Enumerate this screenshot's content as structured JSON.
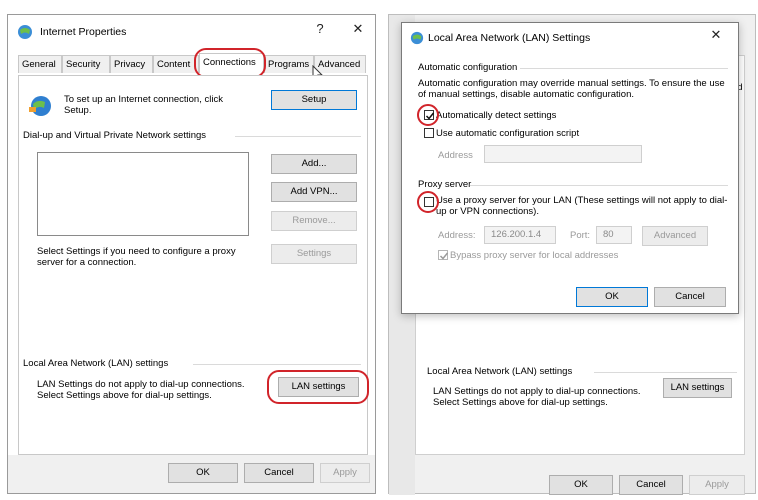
{
  "left_window": {
    "title": "Internet Properties",
    "help": "?",
    "close": "✕",
    "tabs": [
      "General",
      "Security",
      "Privacy",
      "Content",
      "Connections",
      "Programs",
      "Advanced"
    ],
    "setup_text": "To set up an Internet connection, click Setup.",
    "setup_button": "Setup",
    "dialup_group": "Dial-up and Virtual Private Network settings",
    "add_button": "Add...",
    "add_vpn_button": "Add VPN...",
    "remove_button": "Remove...",
    "settings_button": "Settings",
    "proxy_hint": "Select Settings if you need to configure a proxy server for a connection.",
    "lan_group": "Local Area Network (LAN) settings",
    "lan_text": "LAN Settings do not apply to dial-up connections. Select Settings above for dial-up settings.",
    "lan_button": "LAN settings",
    "ok": "OK",
    "cancel": "Cancel",
    "apply": "Apply"
  },
  "right_back": {
    "partial_tab": "ed",
    "lan_group": "Local Area Network (LAN) settings",
    "lan_text": "LAN Settings do not apply to dial-up connections. Select Settings above for dial-up settings.",
    "lan_button": "LAN settings",
    "ok": "OK",
    "cancel": "Cancel",
    "apply": "Apply"
  },
  "lan_dialog": {
    "title": "Local Area Network (LAN) Settings",
    "close": "✕",
    "auto_group": "Automatic configuration",
    "auto_desc": "Automatic configuration may override manual settings.  To ensure the use of manual settings, disable automatic configuration.",
    "auto_detect": "Automatically detect settings",
    "auto_detect_checked": true,
    "auto_script": "Use automatic configuration script",
    "address_label": "Address",
    "proxy_group": "Proxy server",
    "use_proxy": "Use a proxy server for your LAN (These settings will not apply to dial-up or VPN connections).",
    "proxy_address_label": "Address:",
    "proxy_address_value": "126.200.1.4",
    "port_label": "Port:",
    "port_value": "80",
    "advanced_button": "Advanced",
    "bypass": "Bypass proxy server for local addresses",
    "ok": "OK",
    "cancel": "Cancel"
  },
  "colors": {
    "highlight": "#d1242a",
    "focus": "#0078d7"
  }
}
